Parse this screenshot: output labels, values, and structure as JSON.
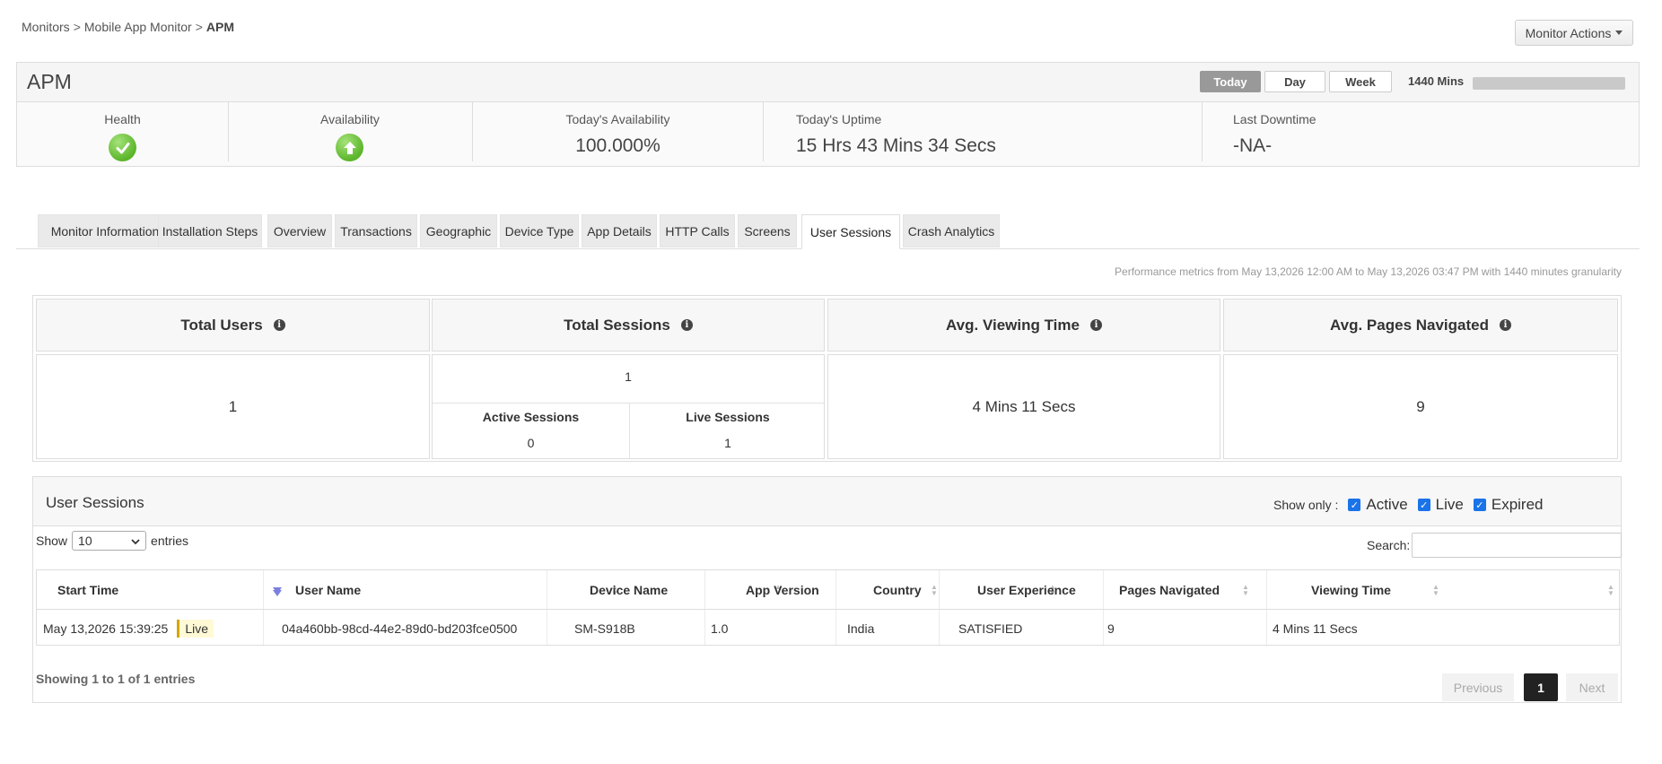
{
  "breadcrumb": {
    "item1": "Monitors",
    "sep1": ">",
    "item2": "Mobile App Monitor",
    "sep2": ">",
    "current": "APM"
  },
  "header": {
    "monitor_actions": "Monitor Actions",
    "title": "APM",
    "periods": {
      "today": "Today",
      "day": "Day",
      "week": "Week"
    },
    "granularity": "1440 Mins",
    "health_label": "Health",
    "health_icon": "check-circle-icon",
    "availability_label": "Availability",
    "availability_icon": "up-arrow-circle-icon",
    "todays_availability_label": "Today's Availability",
    "todays_availability_value": "100.000%",
    "todays_uptime_label": "Today's Uptime",
    "todays_uptime_value": "15 Hrs 43 Mins 34 Secs",
    "last_downtime_label": "Last Downtime",
    "last_downtime_value": "-NA-",
    "status_color": "#5cb52b"
  },
  "tabs": [
    "Monitor Information",
    "Installation Steps",
    "Overview",
    "Transactions",
    "Geographic",
    "Device Type",
    "App Details",
    "HTTP Calls",
    "Screens",
    "User Sessions",
    "Crash Analytics"
  ],
  "active_tab": "User Sessions",
  "perf_note": "Performance metrics from May 13,2026 12:00 AM to May 13,2026 03:47 PM with 1440 minutes granularity",
  "stats": {
    "total_users_label": "Total Users",
    "total_users_value": "1",
    "total_sessions_label": "Total Sessions",
    "total_sessions_value": "1",
    "active_sessions_label": "Active Sessions",
    "active_sessions_value": "0",
    "live_sessions_label": "Live Sessions",
    "live_sessions_value": "1",
    "avg_viewing_label": "Avg. Viewing Time",
    "avg_viewing_value": "4 Mins 11 Secs",
    "avg_pages_label": "Avg. Pages Navigated",
    "avg_pages_value": "9",
    "info_glyph": "i"
  },
  "sessions": {
    "title": "User Sessions",
    "show_only_label": "Show only :",
    "filters": {
      "active": "Active",
      "live": "Live",
      "expired": "Expired"
    },
    "show_label": "Show",
    "page_size": "10",
    "entries_label": "entries",
    "search_label": "Search:",
    "columns": [
      "Start Time",
      "User Name",
      "Device Name",
      "App Version",
      "Country",
      "User Experience",
      "Pages Navigated",
      "Viewing Time"
    ],
    "rows": [
      {
        "start_time": "May 13,2026 15:39:25",
        "status": "Live",
        "user_name": "04a460bb-98cd-44e2-89d0-bd203fce0500",
        "device_name": "SM-S918B",
        "app_version": "1.0",
        "country": "India",
        "user_experience": "SATISFIED",
        "pages_navigated": "9",
        "viewing_time": "4 Mins 11 Secs"
      }
    ],
    "showing": "Showing 1 to 1 of 1 entries",
    "pager": {
      "previous": "Previous",
      "page": "1",
      "next": "Next"
    }
  }
}
